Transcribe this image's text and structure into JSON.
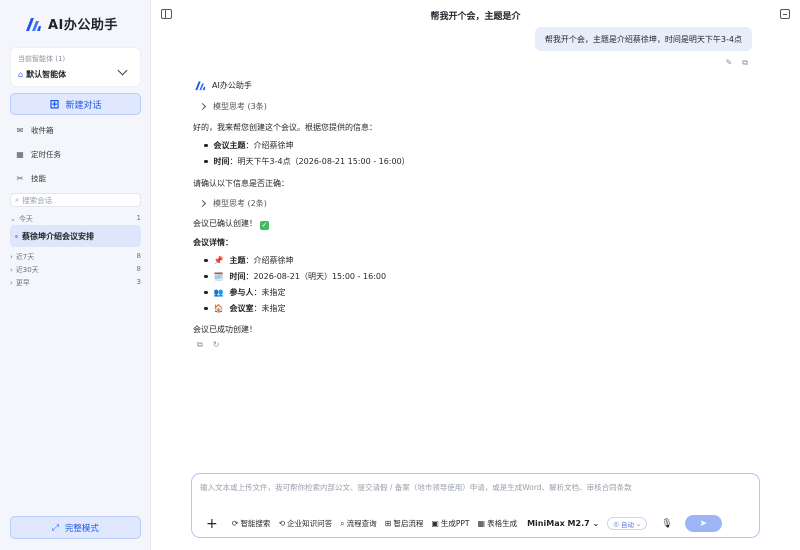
{
  "app": {
    "title": "AI办公助手"
  },
  "sidebar": {
    "agent_caption": "当前智能体 (1)",
    "agent_name": "默认智能体",
    "new_chat_label": "新建对话",
    "nav": [
      {
        "label": "收件箱",
        "icon": "mail-icon"
      },
      {
        "label": "定时任务",
        "icon": "calendar-icon"
      },
      {
        "label": "技能",
        "icon": "skills-icon"
      }
    ],
    "search_placeholder": "搜索会话",
    "groups": [
      {
        "label": "今天",
        "count": "1"
      },
      {
        "label": "近7天",
        "count": "8"
      },
      {
        "label": "近30天",
        "count": "8"
      },
      {
        "label": "更早",
        "count": "3"
      }
    ],
    "active_conversation": "蔡徐坤介绍会议安排",
    "full_mode_label": "完整模式"
  },
  "header": {
    "title": "帮我开个会，主题是介"
  },
  "user_message": "帮我开个会，主题是介绍蔡徐坤，时间是明天下午3-4点",
  "assistant": {
    "name": "AI办公助手",
    "think1": "模型思考 (3条)",
    "intro": "好的，我来帮您创建这个会议。根据您提供的信息：",
    "topic_label": "会议主题",
    "topic_value": "：介绍蔡徐坤",
    "time_label": "时间",
    "time_value": "：明天下午3-4点（2026-08-21 15:00 - 16:00）",
    "confirm_q": "请确认以下信息是否正确：",
    "think2": "模型思考 (2条)",
    "created": "会议已确认创建！",
    "details_title": "会议详情：",
    "details": [
      {
        "emoji": "📌",
        "label": "主题",
        "value": "：介绍蔡徐坤"
      },
      {
        "emoji": "🗓️",
        "label": "时间",
        "value": "：2026-08-21（明天）15:00 - 16:00"
      },
      {
        "emoji": "👥",
        "label": "参与人",
        "value": "：未指定"
      },
      {
        "emoji": "🏠",
        "label": "会议室",
        "value": "：未指定"
      }
    ],
    "success": "会议已成功创建！"
  },
  "input": {
    "placeholder": "输入文本或上传文件，我可帮你检索内部公文、提交请假 / 备案（地市领导使用）申请，或是生成Word、解析文档、审核合同条款",
    "tools": [
      "智能搜索",
      "企业知识问答",
      "流程查询",
      "智启流程",
      "生成PPT",
      "表格生成"
    ],
    "model": "MiniMax M2.7",
    "auto_label": "自动"
  },
  "colors": {
    "accent": "#1f56e8",
    "user_bubble": "#e8edfb",
    "sidebar_bg": "#f4f6fb"
  }
}
